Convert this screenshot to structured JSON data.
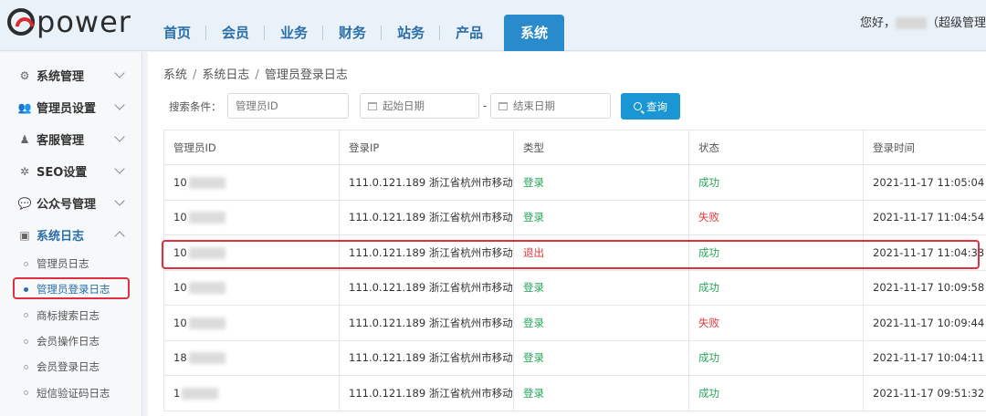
{
  "logo": {
    "text": "power"
  },
  "nav": {
    "tabs": [
      {
        "label": "首页"
      },
      {
        "label": "会员"
      },
      {
        "label": "业务"
      },
      {
        "label": "财务"
      },
      {
        "label": "站务"
      },
      {
        "label": "产品"
      },
      {
        "label": "系统"
      }
    ],
    "active_tab": "系统"
  },
  "header": {
    "greeting_prefix": "您好，",
    "role": "（超级管理"
  },
  "sidebar": {
    "groups": [
      {
        "label": "系统管理",
        "icon": "gears-icon"
      },
      {
        "label": "管理员设置",
        "icon": "users-icon"
      },
      {
        "label": "客服管理",
        "icon": "headset-icon"
      },
      {
        "label": "SEO设置",
        "icon": "gear-icon"
      },
      {
        "label": "公众号管理",
        "icon": "wechat-icon"
      },
      {
        "label": "系统日志",
        "icon": "log-icon"
      }
    ],
    "submenu": [
      {
        "label": "管理员日志"
      },
      {
        "label": "管理员登录日志"
      },
      {
        "label": "商标搜索日志"
      },
      {
        "label": "会员操作日志"
      },
      {
        "label": "会员登录日志"
      },
      {
        "label": "短信验证码日志"
      }
    ]
  },
  "breadcrumb": {
    "items": [
      "系统",
      "系统日志",
      "管理员登录日志"
    ],
    "separator": "/"
  },
  "search": {
    "label": "搜索条件：",
    "admin_id_placeholder": "管理员ID",
    "start_date_placeholder": "起始日期",
    "end_date_placeholder": "结束日期",
    "range_dash": "-",
    "query_button": "查询"
  },
  "table": {
    "columns": [
      "管理员ID",
      "登录IP",
      "类型",
      "状态",
      "登录时间"
    ],
    "rows": [
      {
        "id_prefix": "10",
        "ip": "111.0.121.189 浙江省杭州市移动",
        "type": "登录",
        "status": "成功",
        "time": "2021-11-17 11:05:04"
      },
      {
        "id_prefix": "10",
        "ip": "111.0.121.189 浙江省杭州市移动",
        "type": "登录",
        "status": "失败",
        "time": "2021-11-17 11:04:54"
      },
      {
        "id_prefix": "10",
        "ip": "111.0.121.189 浙江省杭州市移动",
        "type": "退出",
        "status": "成功",
        "time": "2021-11-17 11:04:33"
      },
      {
        "id_prefix": "10",
        "ip": "111.0.121.189 浙江省杭州市移动",
        "type": "登录",
        "status": "成功",
        "time": "2021-11-17 10:09:58"
      },
      {
        "id_prefix": "10",
        "ip": "111.0.121.189 浙江省杭州市移动",
        "type": "登录",
        "status": "失败",
        "time": "2021-11-17 10:09:44"
      },
      {
        "id_prefix": "18",
        "ip": "111.0.121.189 浙江省杭州市移动",
        "type": "登录",
        "status": "成功",
        "time": "2021-11-17 10:04:11"
      },
      {
        "id_prefix": "1",
        "ip": "111.0.121.189 浙江省杭州市移动",
        "type": "登录",
        "status": "成功",
        "time": "2021-11-17 09:51:32"
      }
    ]
  },
  "colors": {
    "accent": "#2a8bcc",
    "success": "#27a65a",
    "fail": "#e2343d",
    "highlight": "#e0303f"
  }
}
